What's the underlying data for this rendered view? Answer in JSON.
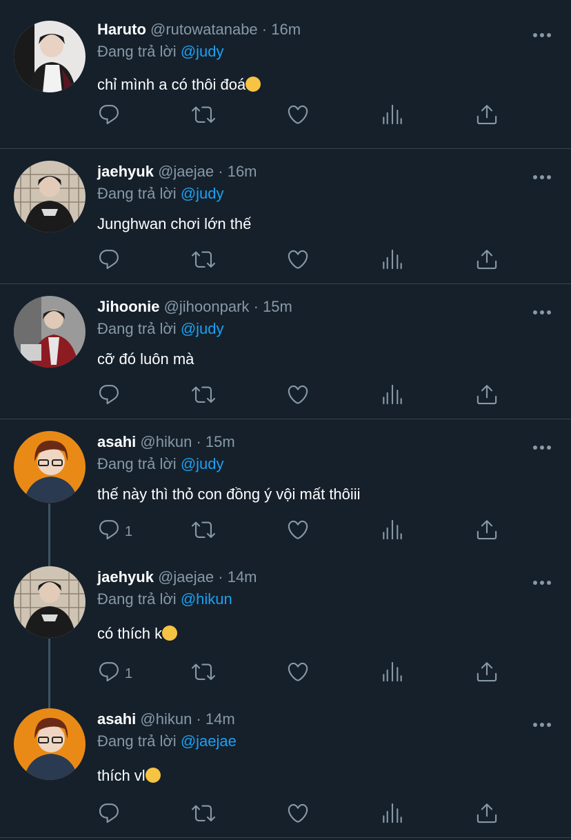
{
  "reply_prefix": "Đang trả lời",
  "tweets": [
    {
      "name": "Haruto",
      "handle": "@rutowatanabe",
      "time": "16m",
      "mention": "@judy",
      "text": "chỉ mình a có thôi đoá",
      "reply_count": "",
      "avatar_color": "#2c2a30"
    },
    {
      "name": "jaehyuk",
      "handle": "@jaejae",
      "time": "16m",
      "mention": "@judy",
      "text": "Junghwan chơi lớn thế",
      "reply_count": "",
      "avatar_color": "#b9b0a2"
    },
    {
      "name": "Jihoonie",
      "handle": "@jihoonpark",
      "time": "15m",
      "mention": "@judy",
      "text": "cỡ đó luôn mà",
      "reply_count": "",
      "avatar_color": "#8a8a8a"
    },
    {
      "name": "asahi",
      "handle": "@hikun",
      "time": "15m",
      "mention": "@judy",
      "text": "thế này thì thỏ con đồng ý vội mất thôiii",
      "reply_count": "1",
      "avatar_color": "#e88a1c"
    },
    {
      "name": "jaehyuk",
      "handle": "@jaejae",
      "time": "14m",
      "mention": "@hikun",
      "text": "có thích k",
      "reply_count": "1",
      "avatar_color": "#b9b0a2"
    },
    {
      "name": "asahi",
      "handle": "@hikun",
      "time": "14m",
      "mention": "@jaejae",
      "text": "thích vl",
      "reply_count": "",
      "avatar_color": "#e88a1c"
    }
  ],
  "colors": {
    "background": "#15202b",
    "divider": "#38444d",
    "muted": "#8899a6",
    "link": "#1da1f2"
  },
  "icons": [
    "reply-icon",
    "retweet-icon",
    "like-icon",
    "analytics-icon",
    "share-icon",
    "more-icon"
  ]
}
